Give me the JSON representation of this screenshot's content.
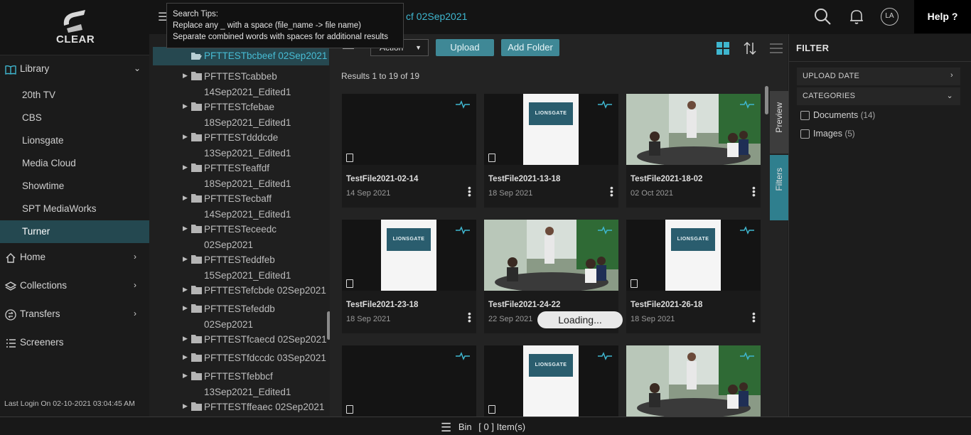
{
  "brand": {
    "name": "CLEAR"
  },
  "breadcrumb": {
    "current": "cf 02Sep2021"
  },
  "tooltip": {
    "title": "Search Tips:",
    "line1": "Replace any _ with a space (file_name -> file name)",
    "line2": "Separate combined words with spaces for additional results"
  },
  "header": {
    "avatar_initials": "LA",
    "help_label": "Help ?"
  },
  "sidebar": {
    "library_label": "Library",
    "library_items": [
      {
        "label": "20th TV"
      },
      {
        "label": "CBS"
      },
      {
        "label": "Lionsgate"
      },
      {
        "label": "Media Cloud"
      },
      {
        "label": "Showtime"
      },
      {
        "label": "SPT MediaWorks"
      },
      {
        "label": "Turner",
        "active": true
      }
    ],
    "nav": [
      {
        "label": "Home",
        "icon": "home-icon"
      },
      {
        "label": "Collections",
        "icon": "layers-icon"
      },
      {
        "label": "Transfers",
        "icon": "transfer-icon"
      },
      {
        "label": "Screeners",
        "icon": "list-icon"
      }
    ],
    "last_login": "Last Login On 02-10-2021 03:04:45 AM"
  },
  "tree": {
    "selected": "PFTTESTbcbeef 02Sep2021",
    "folders": [
      {
        "line1": "PFTTESTcabbeb",
        "line2": "14Sep2021_Edited1"
      },
      {
        "line1": "PFTTESTcfebae",
        "line2": "18Sep2021_Edited1"
      },
      {
        "line1": "PFTTESTdddcde",
        "line2": "13Sep2021_Edited1"
      },
      {
        "line1": "PFTTESTeaffdf",
        "line2": "18Sep2021_Edited1"
      },
      {
        "line1": "PFTTESTecbaff",
        "line2": "14Sep2021_Edited1"
      },
      {
        "line1": "PFTTESTeceedc",
        "line2": "02Sep2021"
      },
      {
        "line1": "PFTTESTeddfeb",
        "line2": "15Sep2021_Edited1"
      },
      {
        "line1": "PFTTESTefcbde 02Sep2021",
        "line2": ""
      },
      {
        "line1": "PFTTESTefeddb",
        "line2": "02Sep2021"
      },
      {
        "line1": "PFTTESTfcaecd 02Sep2021",
        "line2": ""
      },
      {
        "line1": "PFTTESTfdccdc 03Sep2021",
        "line2": ""
      },
      {
        "line1": "PFTTESTfebbcf",
        "line2": "13Sep2021_Edited1"
      },
      {
        "line1": "PFTTESTffeaec 02Sep2021",
        "line2": ""
      }
    ]
  },
  "toolbar": {
    "action_label": "Action",
    "upload_label": "Upload",
    "add_folder_label": "Add Folder"
  },
  "results": {
    "summary": "Results 1 to 19 of 19"
  },
  "cards": [
    {
      "title": "TestFile2021-02-14",
      "date": "14 Sep 2021",
      "thumb": "dark"
    },
    {
      "title": "TestFile2021-13-18",
      "date": "18 Sep 2021",
      "thumb": "lionsgate"
    },
    {
      "title": "TestFile2021-18-02",
      "date": "02 Oct 2021",
      "thumb": "meeting"
    },
    {
      "title": "TestFile2021-23-18",
      "date": "18 Sep 2021",
      "thumb": "lionsgate"
    },
    {
      "title": "TestFile2021-24-22",
      "date": "22 Sep 2021",
      "thumb": "meeting"
    },
    {
      "title": "TestFile2021-26-18",
      "date": "18 Sep 2021",
      "thumb": "lionsgate"
    },
    {
      "title": "",
      "date": "",
      "thumb": "dark"
    },
    {
      "title": "",
      "date": "",
      "thumb": "lionsgate"
    },
    {
      "title": "",
      "date": "",
      "thumb": "meeting"
    }
  ],
  "thumb_text": {
    "lionsgate": "LIONSGATE"
  },
  "loading_text": "Loading...",
  "side_tabs": {
    "preview": "Preview",
    "filters": "Filters"
  },
  "filter": {
    "heading": "FILTER",
    "upload_date": "UPLOAD DATE",
    "categories": "CATEGORIES",
    "options": [
      {
        "label": "Documents",
        "count": "(14)"
      },
      {
        "label": "Images",
        "count": "(5)"
      }
    ]
  },
  "bin": {
    "label": "Bin",
    "count": "[ 0 ] Item(s)"
  },
  "colors": {
    "accent": "#3f8896",
    "link": "#3fb6cf",
    "active_bg": "#244850"
  }
}
